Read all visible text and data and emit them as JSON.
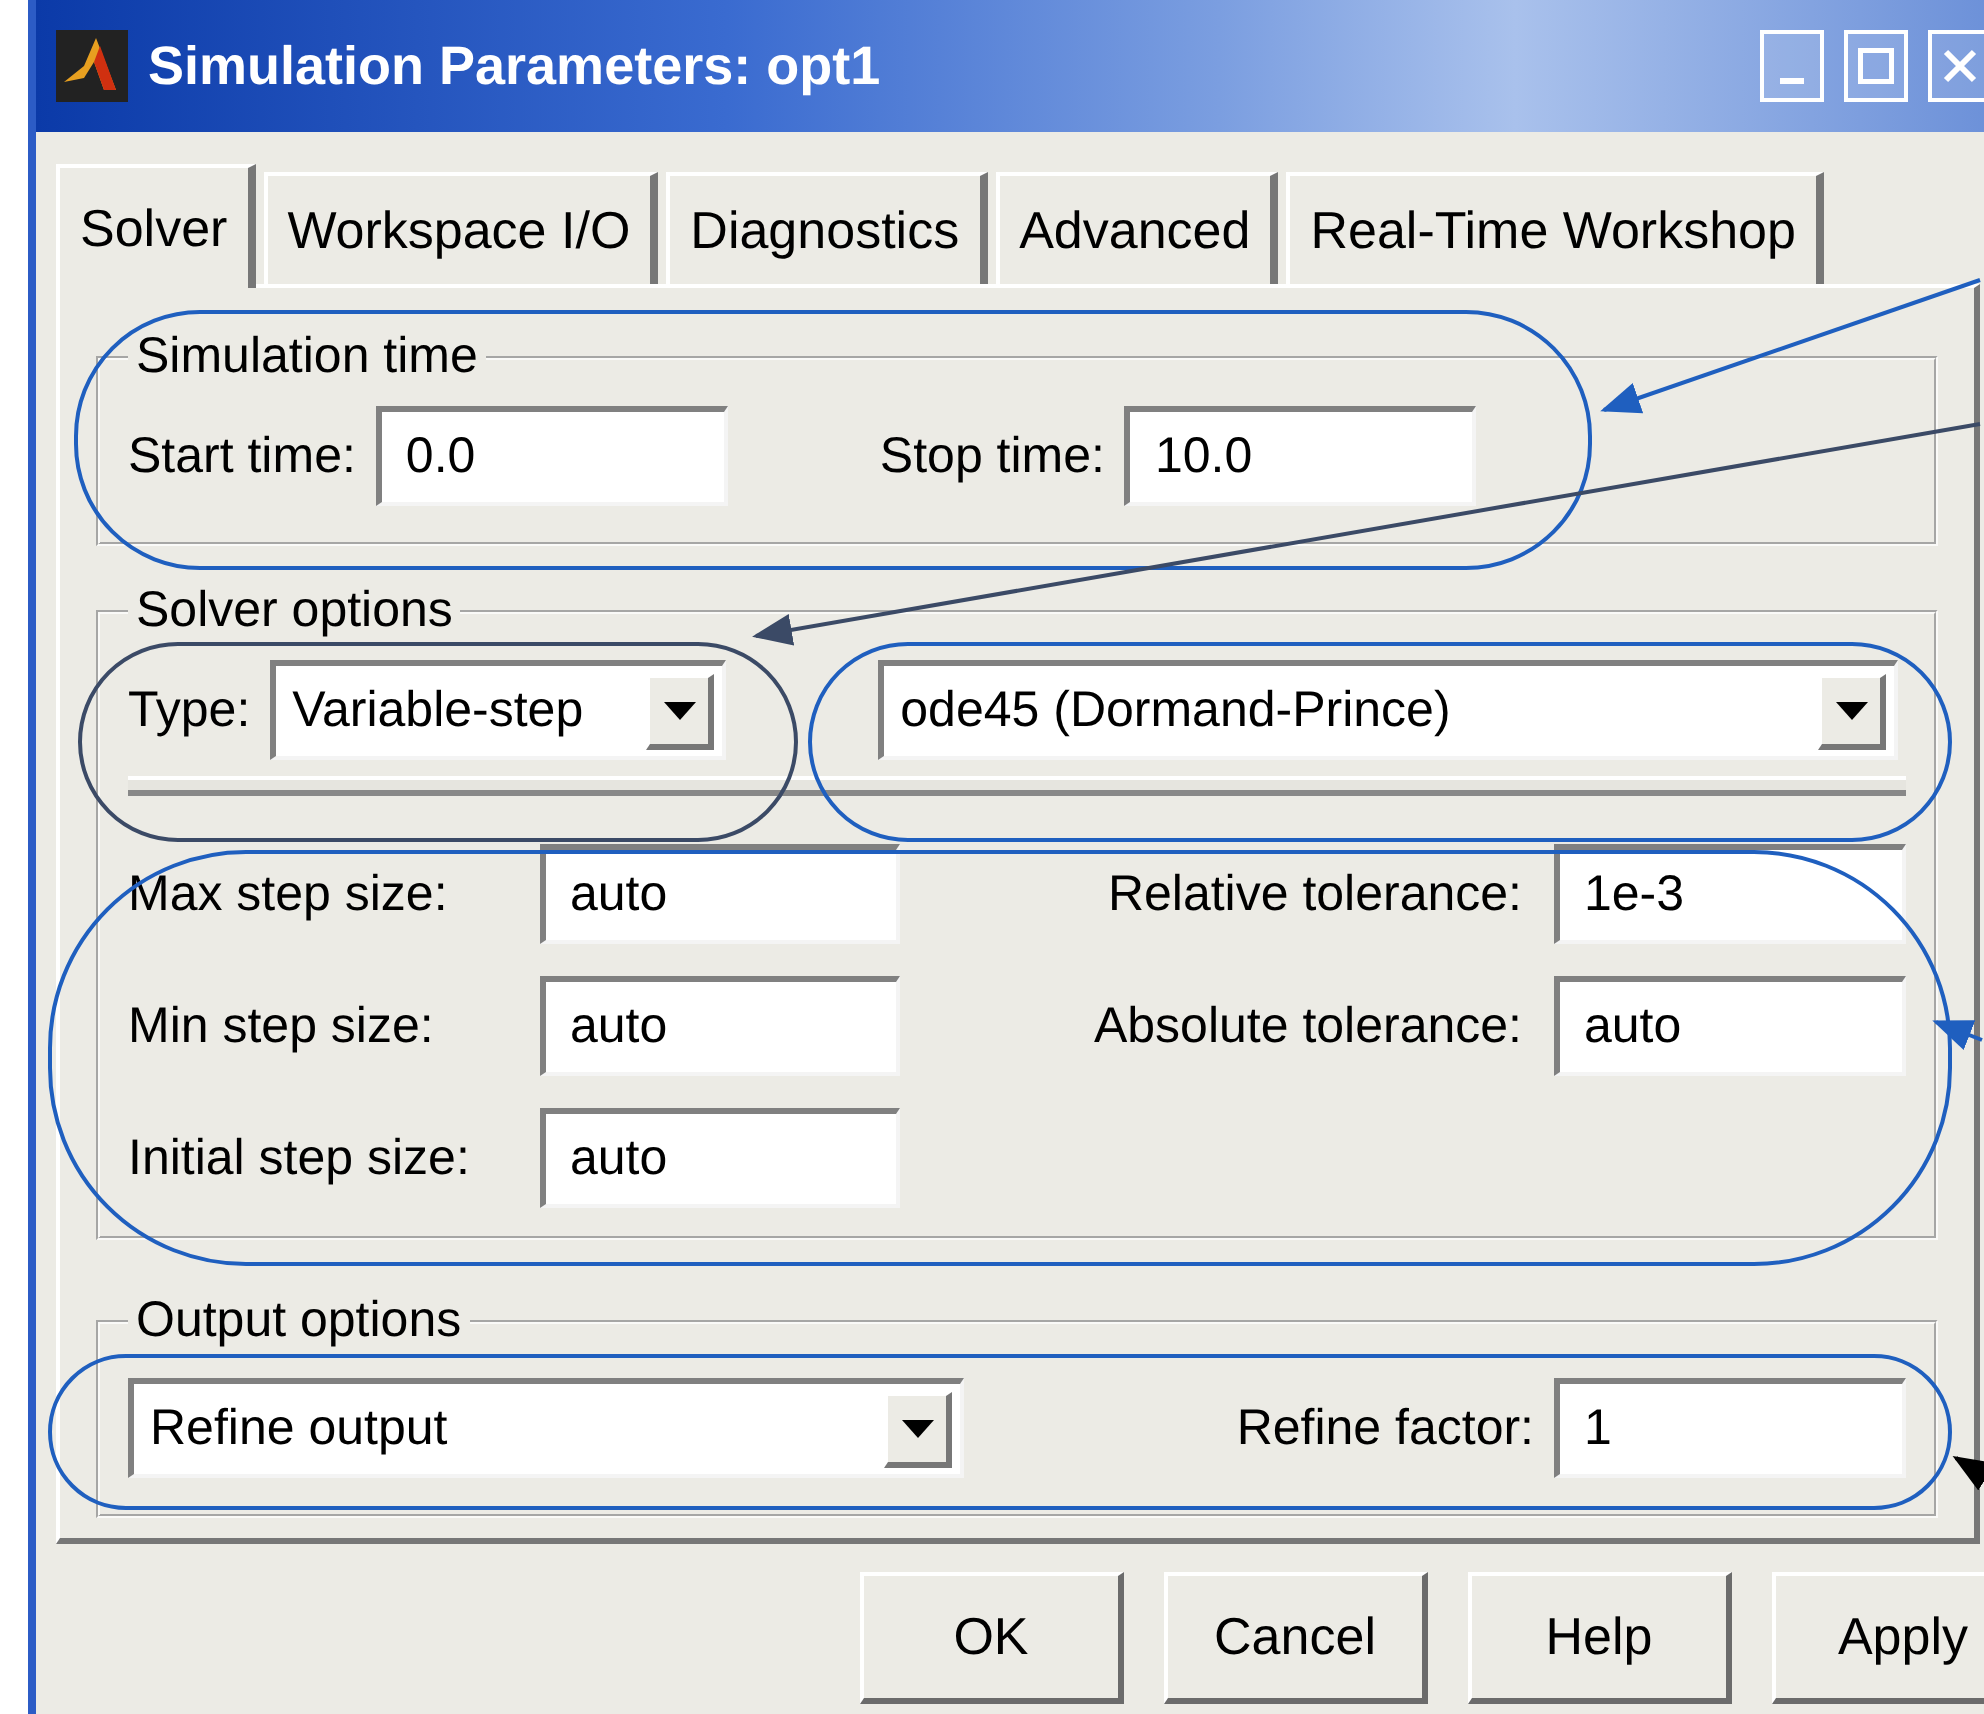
{
  "window": {
    "title": "Simulation Parameters: opt1"
  },
  "tabs": [
    {
      "label": "Solver",
      "selected": true
    },
    {
      "label": "Workspace I/O",
      "selected": false
    },
    {
      "label": "Diagnostics",
      "selected": false
    },
    {
      "label": "Advanced",
      "selected": false
    },
    {
      "label": "Real-Time Workshop",
      "selected": false
    }
  ],
  "simulation_time": {
    "title": "Simulation time",
    "start_time": {
      "label": "Start time:",
      "value": "0.0"
    },
    "stop_time": {
      "label": "Stop time:",
      "value": "10.0"
    }
  },
  "solver_options": {
    "title": "Solver options",
    "type_label": "Type:",
    "type_value": "Variable-step",
    "solver_value": "ode45 (Dormand-Prince)",
    "left_fields": [
      {
        "label": "Max step size:",
        "value": "auto"
      },
      {
        "label": "Min step size:",
        "value": "auto"
      },
      {
        "label": "Initial step size:",
        "value": "auto"
      }
    ],
    "right_fields": [
      {
        "label": "Relative tolerance:",
        "value": "1e-3"
      },
      {
        "label": "Absolute tolerance:",
        "value": "auto"
      }
    ]
  },
  "output_options": {
    "title": "Output options",
    "mode": "Refine output",
    "refine_factor": {
      "label": "Refine factor:",
      "value": "1"
    }
  },
  "buttons": [
    "OK",
    "Cancel",
    "Help",
    "Apply"
  ]
}
